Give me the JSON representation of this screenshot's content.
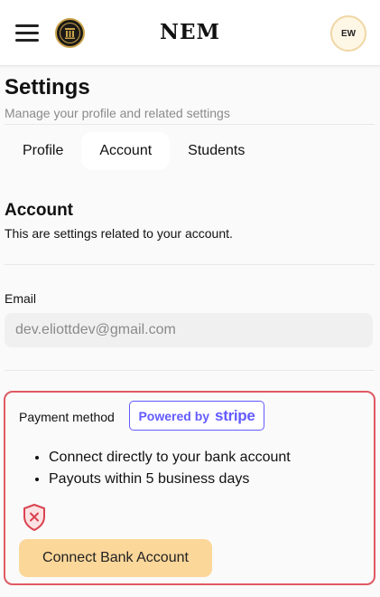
{
  "header": {
    "brand": "NEM",
    "avatar_initials": "EW"
  },
  "page": {
    "title": "Settings",
    "subtitle": "Manage your profile and related settings"
  },
  "tabs": [
    {
      "label": "Profile",
      "active": false
    },
    {
      "label": "Account",
      "active": true
    },
    {
      "label": "Students",
      "active": false
    }
  ],
  "account": {
    "title": "Account",
    "description": "This are settings related to your account."
  },
  "email": {
    "label": "Email",
    "value": "dev.eliottdev@gmail.com"
  },
  "payment": {
    "label": "Payment method",
    "badge_prefix": "Powered by",
    "badge_brand": "stripe",
    "features": [
      "Connect directly to your bank account",
      "Payouts within 5 business days"
    ],
    "status_icon": "shield-x-icon",
    "connect_label": "Connect Bank Account"
  },
  "colors": {
    "accent_button": "#fcd79a",
    "stripe_purple": "#635bff",
    "alert_border": "#e05a63"
  }
}
